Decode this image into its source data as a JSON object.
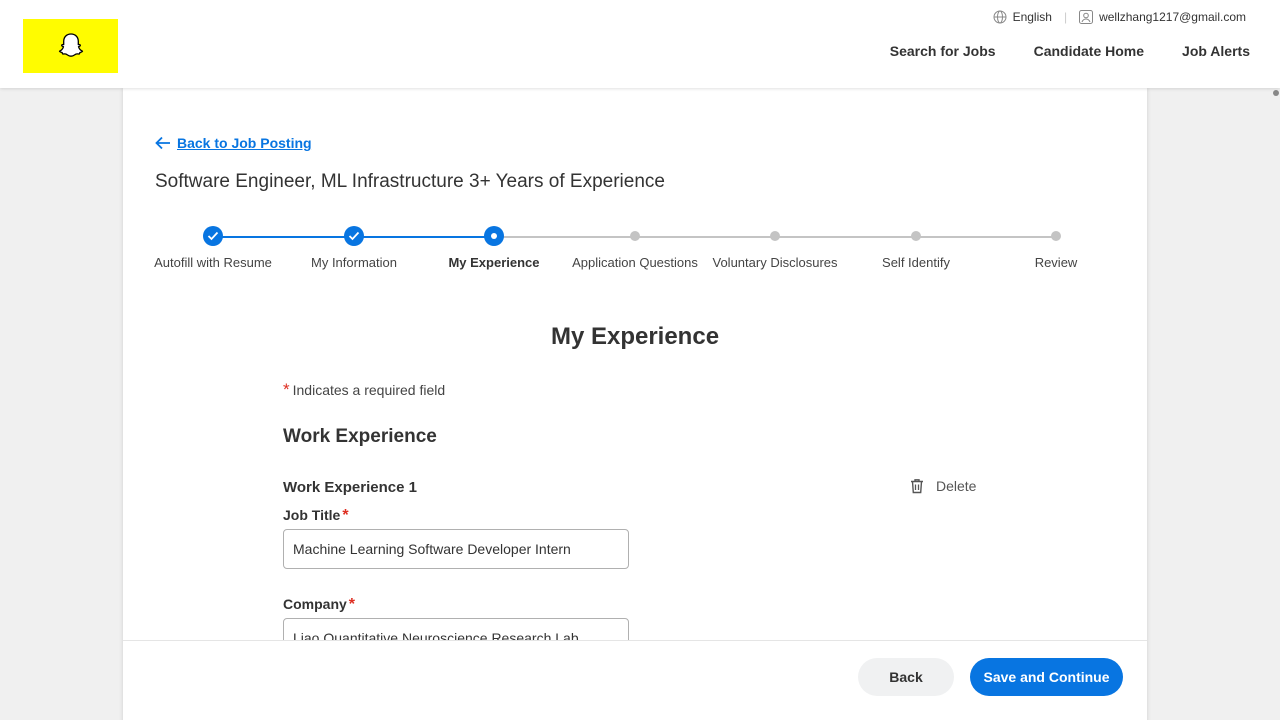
{
  "header": {
    "language": "English",
    "user_email": "wellzhang1217@gmail.com",
    "nav": [
      "Search for Jobs",
      "Candidate Home",
      "Job Alerts"
    ]
  },
  "page": {
    "back_link": "Back to Job Posting",
    "job_title": "Software Engineer, ML Infrastructure 3+ Years of Experience",
    "section_title": "My Experience",
    "required_note": "Indicates a required field",
    "required_marker": "*"
  },
  "stepper": {
    "steps": [
      {
        "label": "Autofill with Resume",
        "state": "done"
      },
      {
        "label": "My Information",
        "state": "done"
      },
      {
        "label": "My Experience",
        "state": "current"
      },
      {
        "label": "Application Questions",
        "state": "todo"
      },
      {
        "label": "Voluntary Disclosures",
        "state": "todo"
      },
      {
        "label": "Self Identify",
        "state": "todo"
      },
      {
        "label": "Review",
        "state": "todo"
      }
    ]
  },
  "work_experience": {
    "title": "Work Experience",
    "entry_title": "Work Experience 1",
    "delete_label": "Delete",
    "job_title_label": "Job Title",
    "job_title_value": "Machine Learning Software Developer Intern",
    "company_label": "Company",
    "company_value": "Liao Quantitative Neuroscience Research Lab"
  },
  "footer": {
    "back_label": "Back",
    "save_label": "Save and Continue"
  },
  "colors": {
    "accent": "#0875e1",
    "logo_bg": "#fffc00",
    "required": "#de2e21"
  }
}
